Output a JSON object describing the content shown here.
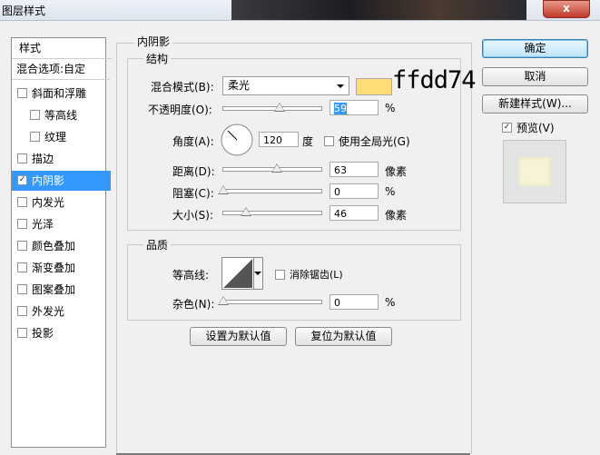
{
  "window": {
    "title": "图层样式",
    "close_glyph": "x"
  },
  "sidebar": {
    "items": [
      {
        "label": "样式",
        "checkbox": false,
        "checked": false
      },
      {
        "label": "混合选项:自定",
        "checkbox": false,
        "checked": false
      },
      {
        "label": "斜面和浮雕",
        "checkbox": true,
        "checked": false
      },
      {
        "label": "等高线",
        "checkbox": true,
        "checked": false
      },
      {
        "label": "纹理",
        "checkbox": true,
        "checked": false
      },
      {
        "label": "描边",
        "checkbox": true,
        "checked": false
      },
      {
        "label": "内阴影",
        "checkbox": true,
        "checked": true
      },
      {
        "label": "内发光",
        "checkbox": true,
        "checked": false
      },
      {
        "label": "光泽",
        "checkbox": true,
        "checked": false
      },
      {
        "label": "颜色叠加",
        "checkbox": true,
        "checked": false
      },
      {
        "label": "渐变叠加",
        "checkbox": true,
        "checked": false
      },
      {
        "label": "图案叠加",
        "checkbox": true,
        "checked": false
      },
      {
        "label": "外发光",
        "checkbox": true,
        "checked": false
      },
      {
        "label": "投影",
        "checkbox": true,
        "checked": false
      }
    ]
  },
  "panel": {
    "title": "内阴影",
    "structure": {
      "title": "结构",
      "blend_mode_label": "混合模式(B):",
      "blend_mode_value": "柔光",
      "color_swatch": "#ffdd74",
      "color_annotation": "ffdd74",
      "opacity_label": "不透明度(O):",
      "opacity_value": "59",
      "opacity_unit": "%",
      "angle_label": "角度(A):",
      "angle_value": "120",
      "angle_unit": "度",
      "global_light_label": "使用全局光(G)",
      "distance_label": "距离(D):",
      "distance_value": "63",
      "distance_unit": "像素",
      "choke_label": "阻塞(C):",
      "choke_value": "0",
      "choke_unit": "%",
      "size_label": "大小(S):",
      "size_value": "46",
      "size_unit": "像素"
    },
    "quality": {
      "title": "品质",
      "contour_label": "等高线:",
      "antialias_label": "消除锯齿(L)",
      "noise_label": "杂色(N):",
      "noise_value": "0",
      "noise_unit": "%"
    },
    "make_default_label": "设置为默认值",
    "reset_default_label": "复位为默认值"
  },
  "actions": {
    "ok_label": "确定",
    "cancel_label": "取消",
    "new_style_label": "新建样式(W)...",
    "preview_label": "预览(V)",
    "preview_checked": true,
    "preview_swatch": "#f6f3d8"
  }
}
